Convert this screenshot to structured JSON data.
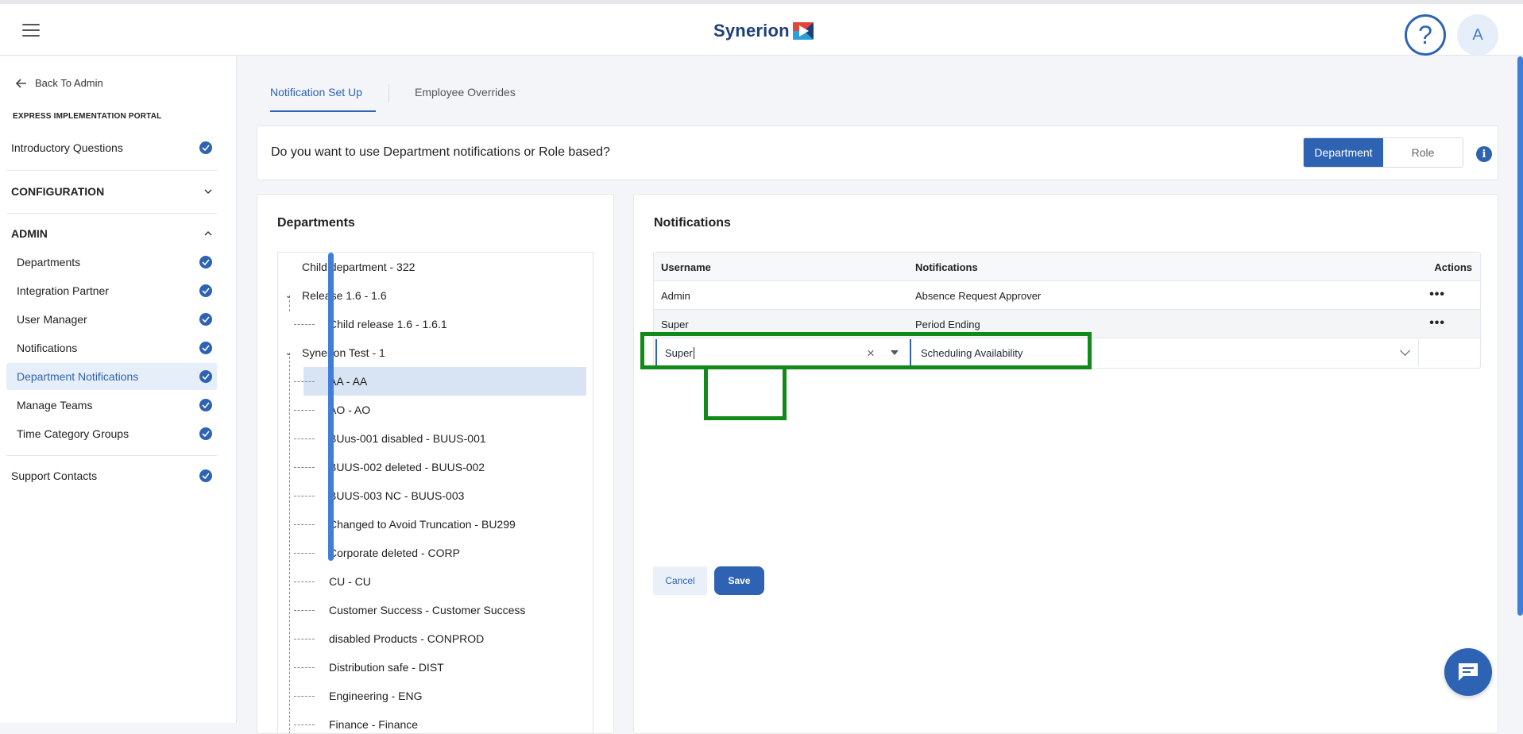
{
  "header": {
    "logo_text": "Synerion",
    "help_label": "?",
    "avatar_initial": "A"
  },
  "sidebar": {
    "back_label": "Back To Admin",
    "portal_label": "EXPRESS IMPLEMENTATION PORTAL",
    "intro": "Introductory Questions",
    "configuration": "CONFIGURATION",
    "admin": "ADMIN",
    "admin_items": [
      "Departments",
      "Integration Partner",
      "User Manager",
      "Notifications",
      "Department Notifications",
      "Manage Teams",
      "Time Category Groups"
    ],
    "support": "Support Contacts"
  },
  "tabs": [
    "Notification Set Up",
    "Employee Overrides"
  ],
  "question": {
    "text": "Do you want to use Department notifications or Role based?",
    "option_department": "Department",
    "option_role": "Role",
    "info_icon": "i"
  },
  "departments": {
    "title": "Departments",
    "nodes": [
      "Child department - 322",
      "Release 1.6 - 1.6",
      "Child release 1.6 - 1.6.1",
      "Synerion Test - 1",
      "AA - AA",
      "AO - AO",
      "BUus-001 disabled - BUUS-001",
      "BUUS-002 deleted - BUUS-002",
      "BUUS-003 NC - BUUS-003",
      "Changed to Avoid Truncation - BU299",
      "Corporate deleted - CORP",
      "CU - CU",
      "Customer Success - Customer Success",
      "disabled Products - CONPROD",
      "Distribution safe - DIST",
      "Engineering - ENG",
      "Finance - Finance"
    ]
  },
  "notifications": {
    "title": "Notifications",
    "columns": {
      "username": "Username",
      "notifications": "Notifications",
      "actions": "Actions"
    },
    "rows": [
      {
        "username": "Admin",
        "notification": "Absence Request Approver",
        "actions": "•••"
      },
      {
        "username": "Super",
        "notification": "Period Ending",
        "actions": "•••"
      }
    ],
    "edit": {
      "username_value": "Super",
      "notification_value": "Scheduling Availability",
      "clear_icon": "×"
    },
    "cancel_label": "Cancel",
    "save_label": "Save"
  },
  "colors": {
    "accent": "#2e63b4",
    "highlight": "#118a1a"
  }
}
